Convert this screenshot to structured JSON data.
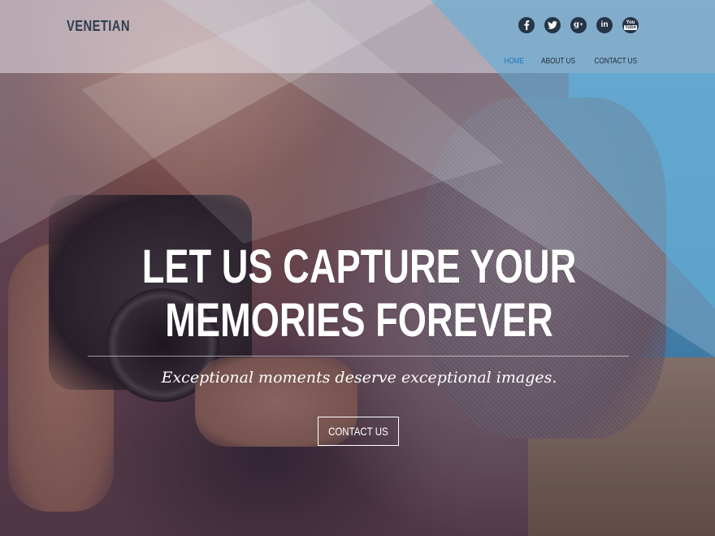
{
  "site": {
    "logo": "VENETIAN"
  },
  "social": {
    "icons": [
      {
        "name": "facebook-icon",
        "glyph": "f"
      },
      {
        "name": "twitter-icon",
        "glyph": "twitter"
      },
      {
        "name": "google-plus-icon",
        "glyph": "g+"
      },
      {
        "name": "linkedin-icon",
        "glyph": "in"
      },
      {
        "name": "youtube-icon",
        "glyph": "You"
      }
    ]
  },
  "nav": {
    "items": [
      {
        "label": "HOME",
        "active": true
      },
      {
        "label": "ABOUT US",
        "active": false
      },
      {
        "label": "CONTACT US",
        "active": false
      }
    ]
  },
  "hero": {
    "headline_line1": "LET US CAPTURE YOUR",
    "headline_line2": "MEMORIES FOREVER",
    "tagline": "Exceptional moments deserve exceptional images.",
    "cta_label": "CONTACT US"
  },
  "colors": {
    "logo": "#2e3d50",
    "nav_active": "#1f78b4",
    "social_bg": "#253446",
    "accent_blue": "#4aa6d6"
  }
}
